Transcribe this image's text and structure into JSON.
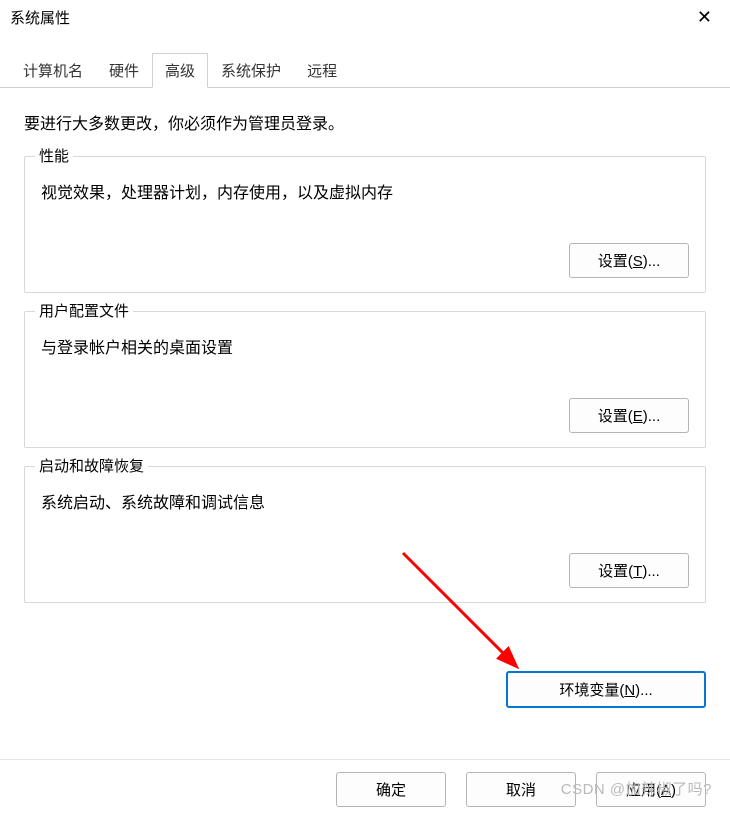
{
  "window": {
    "title": "系统属性",
    "close": "✕"
  },
  "tabs": {
    "computer_name": "计算机名",
    "hardware": "硬件",
    "advanced": "高级",
    "system_protection": "系统保护",
    "remote": "远程"
  },
  "intro": "要进行大多数更改，你必须作为管理员登录。",
  "groups": {
    "performance": {
      "label": "性能",
      "desc": "视觉效果，处理器计划，内存使用，以及虚拟内存",
      "button_prefix": "设置(",
      "button_key": "S",
      "button_suffix": ")..."
    },
    "user_profile": {
      "label": "用户配置文件",
      "desc": "与登录帐户相关的桌面设置",
      "button_prefix": "设置(",
      "button_key": "E",
      "button_suffix": ")..."
    },
    "startup_recovery": {
      "label": "启动和故障恢复",
      "desc": "系统启动、系统故障和调试信息",
      "button_prefix": "设置(",
      "button_key": "T",
      "button_suffix": ")..."
    }
  },
  "env_button": {
    "prefix": "环境变量(",
    "key": "N",
    "suffix": ")..."
  },
  "footer": {
    "ok": "确定",
    "cancel": "取消",
    "apply_prefix": "应用(",
    "apply_key": "A",
    "apply_suffix": ")"
  },
  "watermark": "CSDN @加辣椒了吗?"
}
